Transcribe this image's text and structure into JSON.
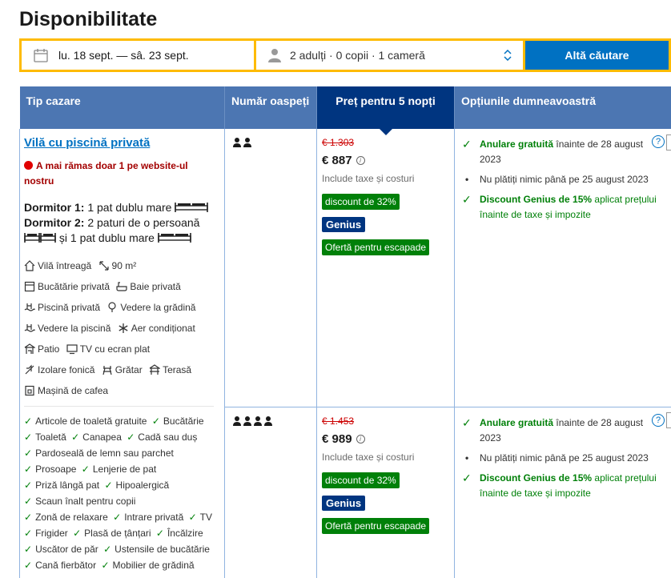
{
  "page": {
    "title": "Disponibilitate"
  },
  "search": {
    "dates": "lu. 18 sept. — sâ. 23 sept.",
    "guests": "2 adulți · 0 copii · 1 cameră",
    "button": "Altă căutare"
  },
  "table": {
    "headers": {
      "type": "Tip cazare",
      "guests": "Număr oaspeți",
      "price": "Preț pentru 5 nopți",
      "options": "Opțiunile dumneavoastră"
    }
  },
  "room": {
    "name": "Vilă cu piscină privată",
    "scarcity": "A mai rămas doar 1 pe website-ul nostru",
    "bed1_label": "Dormitor 1:",
    "bed1_text": "1 pat dublu mare",
    "bed2_label": "Dormitor 2:",
    "bed2_text": "2 paturi de o persoană",
    "bed2_text2": "și 1 pat dublu mare",
    "facilities": [
      {
        "icon": "house-icon",
        "label": "Vilă întreagă"
      },
      {
        "icon": "area-icon",
        "label": "90 m²"
      },
      {
        "icon": "kitchen-icon",
        "label": "Bucătărie privată"
      },
      {
        "icon": "bath-icon",
        "label": "Baie privată"
      },
      {
        "icon": "pool-icon",
        "label": "Piscină privată"
      },
      {
        "icon": "garden-icon",
        "label": "Vedere la grădină"
      },
      {
        "icon": "pool-view-icon",
        "label": "Vedere la piscină"
      },
      {
        "icon": "snowflake-icon",
        "label": "Aer condiționat"
      },
      {
        "icon": "patio-icon",
        "label": "Patio"
      },
      {
        "icon": "tv-icon",
        "label": "TV cu ecran plat"
      },
      {
        "icon": "soundproof-icon",
        "label": "Izolare fonică"
      },
      {
        "icon": "grill-icon",
        "label": "Grătar"
      },
      {
        "icon": "terrace-icon",
        "label": "Terasă"
      },
      {
        "icon": "coffee-icon",
        "label": "Mașină de cafea"
      }
    ],
    "amenities": [
      "Articole de toaletă gratuite",
      "Bucătărie",
      "Toaletă",
      "Canapea",
      "Cadă sau duș",
      "Pardoseală de lemn sau parchet",
      "Prosoape",
      "Lenjerie de pat",
      "Priză lângă pat",
      "Hipoalergică",
      "Scaun înalt pentru copii",
      "Zonă de relaxare",
      "Intrare privată",
      "TV",
      "Frigider",
      "Plasă de țânțari",
      "Încălzire",
      "Uscător de păr",
      "Ustensile de bucătărie",
      "Cană fierbător",
      "Mobilier de grădină"
    ]
  },
  "offers": [
    {
      "guests_count": 2,
      "old_price": "€ 1.303",
      "price": "€ 887",
      "tax_note": "Include taxe și costuri",
      "discount": "discount de 32%",
      "genius": "Genius",
      "escape": "Ofertă pentru escapade",
      "cancel_bold": "Anulare gratuită",
      "cancel_rest": "înainte de 28 august 2023",
      "pay_note": "Nu plătiți nimic până pe 25 august 2023",
      "genius_bold": "Discount Genius de 15%",
      "genius_rest": "aplicat prețului înainte de taxe și impozite"
    },
    {
      "guests_count": 4,
      "old_price": "€ 1.453",
      "price": "€ 989",
      "tax_note": "Include taxe și costuri",
      "discount": "discount de 32%",
      "genius": "Genius",
      "escape": "Ofertă pentru escapade",
      "cancel_bold": "Anulare gratuită",
      "cancel_rest": "înainte de 28 august 2023",
      "pay_note": "Nu plătiți nimic până pe 25 august 2023",
      "genius_bold": "Discount Genius de 15%",
      "genius_rest": "aplicat prețului înainte de taxe și impozite"
    }
  ],
  "colors": {
    "header_bg": "#4c76b2",
    "header_highlight": "#003580",
    "accent_blue": "#0071c2",
    "green": "#008009",
    "search_border": "#febb02"
  }
}
